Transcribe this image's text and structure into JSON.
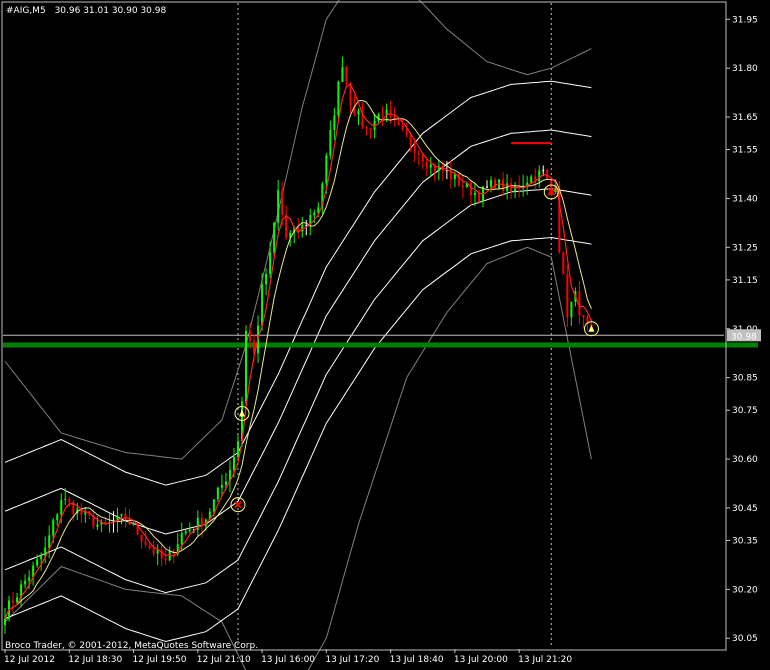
{
  "header": {
    "symbol": "#AIG,M5",
    "ohlc": "30.96 31.01 30.90 30.98"
  },
  "footer": {
    "copyright": "Broco Trader, © 2001-2012, MetaQuotes Software Corp."
  },
  "colors": {
    "background": "#000000",
    "frame": "#c0c0c0",
    "text": "#ffffff",
    "grid_vertical": "#c0c0c0",
    "bull_candle": "#00ff00",
    "bear_candle": "#ff0000",
    "doji_candle": "#ffffff",
    "ma_fast": "#ff2020",
    "ma_slow": "#e8e890",
    "envelope": "#ffffff",
    "bollinger": "#808080",
    "support_line": "#008000",
    "price_line": "#c0c0c0",
    "marker": "#ffff80"
  },
  "chart_data": {
    "type": "candlestick",
    "ylim": [
      30.02,
      32.0
    ],
    "y_ticks": [
      "31.95",
      "31.80",
      "31.65",
      "31.55",
      "31.40",
      "31.25",
      "31.15",
      "31.00",
      "30.85",
      "30.75",
      "30.60",
      "30.45",
      "30.35",
      "30.20",
      "30.05"
    ],
    "x_ticks": [
      "12 Jul 2012",
      "12 Jul 18:30",
      "12 Jul 19:50",
      "12 Jul 21:10",
      "13 Jul 16:00",
      "13 Jul 17:20",
      "13 Jul 18:40",
      "13 Jul 20:00",
      "13 Jul 21:20"
    ],
    "bar_count": 180,
    "current_price": "30.98",
    "horizontal_line_price": 30.95,
    "session_break_bars": [
      58,
      136
    ],
    "path_anchors": [
      [
        0,
        30.13
      ],
      [
        10,
        30.32
      ],
      [
        14,
        30.48
      ],
      [
        18,
        30.44
      ],
      [
        24,
        30.39
      ],
      [
        30,
        30.42
      ],
      [
        36,
        30.33
      ],
      [
        40,
        30.28
      ],
      [
        44,
        30.37
      ],
      [
        50,
        30.42
      ],
      [
        54,
        30.52
      ],
      [
        56,
        30.57
      ],
      [
        58,
        30.66
      ],
      [
        59,
        30.78
      ],
      [
        60,
        31.0
      ],
      [
        62,
        30.92
      ],
      [
        64,
        31.12
      ],
      [
        66,
        31.22
      ],
      [
        68,
        31.42
      ],
      [
        70,
        31.28
      ],
      [
        74,
        31.31
      ],
      [
        78,
        31.38
      ],
      [
        80,
        31.52
      ],
      [
        82,
        31.67
      ],
      [
        84,
        31.82
      ],
      [
        86,
        31.7
      ],
      [
        88,
        31.65
      ],
      [
        90,
        31.61
      ],
      [
        94,
        31.67
      ],
      [
        98,
        31.61
      ],
      [
        102,
        31.56
      ],
      [
        106,
        31.5
      ],
      [
        110,
        31.48
      ],
      [
        114,
        31.44
      ],
      [
        118,
        31.41
      ],
      [
        122,
        31.45
      ],
      [
        126,
        31.42
      ],
      [
        130,
        31.46
      ],
      [
        134,
        31.48
      ],
      [
        136,
        31.42
      ],
      [
        137,
        31.45
      ],
      [
        138,
        31.25
      ],
      [
        140,
        31.05
      ],
      [
        142,
        31.1
      ],
      [
        144,
        31.02
      ],
      [
        146,
        30.98
      ]
    ],
    "envelope_anchors": [
      [
        0,
        30.35
      ],
      [
        14,
        30.42
      ],
      [
        30,
        30.32
      ],
      [
        40,
        30.28
      ],
      [
        50,
        30.31
      ],
      [
        58,
        30.38
      ],
      [
        68,
        30.62
      ],
      [
        80,
        30.95
      ],
      [
        92,
        31.18
      ],
      [
        104,
        31.36
      ],
      [
        116,
        31.47
      ],
      [
        126,
        31.51
      ],
      [
        136,
        31.52
      ],
      [
        146,
        31.5
      ]
    ],
    "envelope_offsets": [
      0.09,
      -0.09,
      0.24,
      -0.24
    ],
    "bollinger_anchors": [
      [
        0,
        30.1,
        30.9
      ],
      [
        14,
        30.27,
        30.68
      ],
      [
        30,
        30.2,
        30.62
      ],
      [
        44,
        30.18,
        30.6
      ],
      [
        54,
        30.1,
        30.72
      ],
      [
        60,
        29.95,
        30.95
      ],
      [
        66,
        29.85,
        31.25
      ],
      [
        74,
        29.92,
        31.68
      ],
      [
        80,
        30.05,
        31.95
      ],
      [
        88,
        30.4,
        32.1
      ],
      [
        100,
        30.85,
        32.05
      ],
      [
        110,
        31.05,
        31.92
      ],
      [
        120,
        31.2,
        31.82
      ],
      [
        130,
        31.25,
        31.78
      ],
      [
        136,
        31.22,
        31.8
      ],
      [
        146,
        30.6,
        31.86
      ]
    ],
    "resistance_segment": {
      "from_bar": 126,
      "to_bar": 136,
      "price": 31.57
    },
    "signal_markers": [
      {
        "bar": 59,
        "price": 30.74,
        "symbol": "up-arrow"
      },
      {
        "bar": 58,
        "price": 30.46,
        "symbol": "cross"
      },
      {
        "bar": 136,
        "price": 31.42,
        "symbol": "cross"
      },
      {
        "bar": 146,
        "price": 31.0,
        "symbol": "up-arrow"
      }
    ]
  }
}
